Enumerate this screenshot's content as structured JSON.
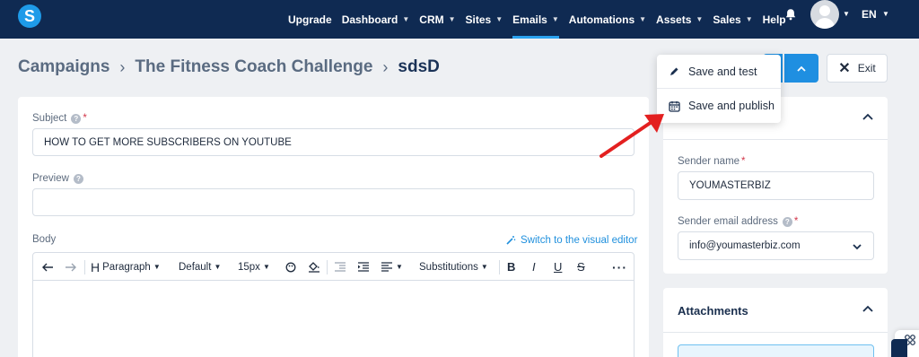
{
  "nav": {
    "logo": "S",
    "items": [
      {
        "label": "Upgrade",
        "has_caret": false,
        "active": false
      },
      {
        "label": "Dashboard",
        "has_caret": true,
        "active": false
      },
      {
        "label": "CRM",
        "has_caret": true,
        "active": false
      },
      {
        "label": "Sites",
        "has_caret": true,
        "active": false
      },
      {
        "label": "Emails",
        "has_caret": true,
        "active": true
      },
      {
        "label": "Automations",
        "has_caret": true,
        "active": false
      },
      {
        "label": "Assets",
        "has_caret": true,
        "active": false
      },
      {
        "label": "Sales",
        "has_caret": true,
        "active": false
      },
      {
        "label": "Help",
        "has_caret": false,
        "active": false
      }
    ],
    "language": "EN",
    "accent_color": "#2aa2ef",
    "background_color": "#0f2a52"
  },
  "breadcrumb": {
    "items": [
      "Campaigns",
      "The Fitness Coach Challenge",
      "sdsD"
    ],
    "separator": "›"
  },
  "actions": {
    "exit_label": "Exit",
    "dropdown": {
      "save_and_test": "Save and test",
      "save_and_publish": "Save and publish"
    }
  },
  "form": {
    "subject_label": "Subject",
    "subject_value": "HOW TO GET MORE SUBSCRIBERS ON YOUTUBE",
    "preview_label": "Preview",
    "preview_value": "",
    "body_label": "Body",
    "switch_editor_link": "Switch to the visual editor",
    "toolbar": {
      "paragraph": "Paragraph",
      "font": "Default",
      "size": "15px",
      "substitutions": "Substitutions"
    }
  },
  "sidebar": {
    "sender_section": {
      "sender_name_label": "Sender name",
      "sender_name_value": "YOUMASTERBIZ",
      "sender_email_label": "Sender email address",
      "sender_email_value": "info@youmasterbiz.com"
    },
    "attachments_title": "Attachments"
  }
}
